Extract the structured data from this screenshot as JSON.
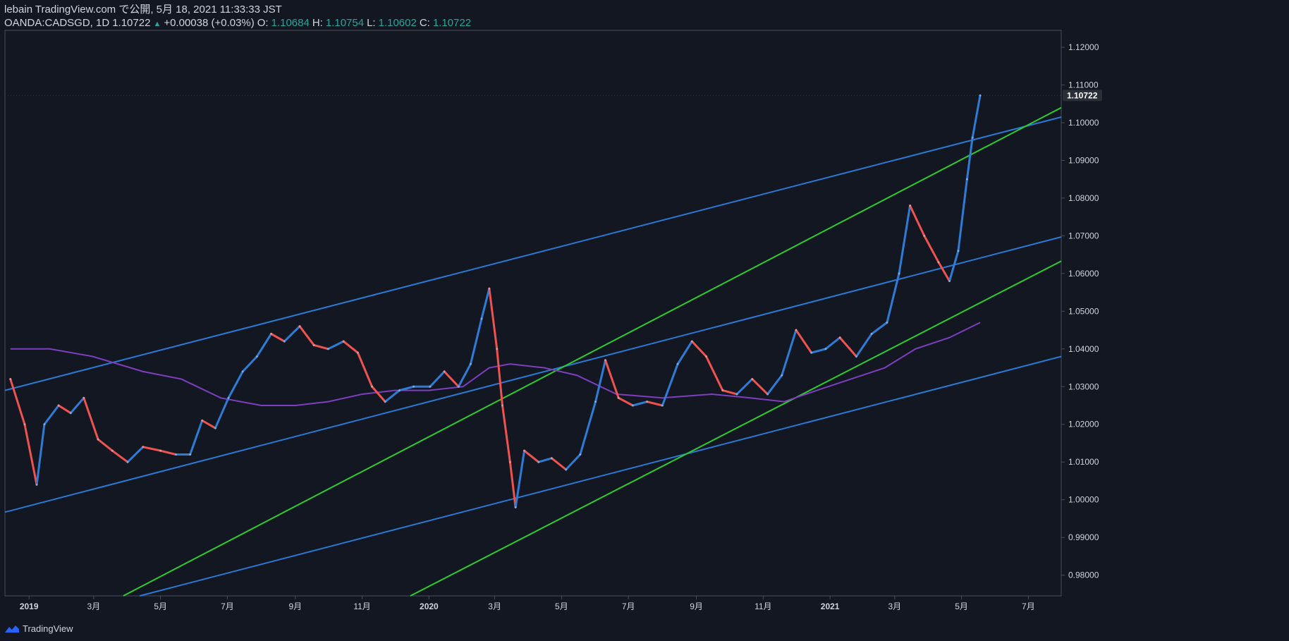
{
  "header": {
    "publisher": "lebain TradingView.com で公開, 5月 18, 2021 11:33:33 JST",
    "symbol": "OANDA:CADSGD, 1D",
    "last": "1.10722",
    "change": "+0.00038 (+0.03%)",
    "o_label": "O:",
    "o_value": "1.10684",
    "h_label": "H:",
    "h_value": "1.10754",
    "l_label": "L:",
    "l_value": "1.10602",
    "c_label": "C:",
    "c_value": "1.10722"
  },
  "footer": {
    "brand": "TradingView"
  },
  "chart_data": {
    "type": "line",
    "title": "",
    "xlabel": "",
    "ylabel": "",
    "ylim": [
      0.9745,
      1.1245
    ],
    "x_tick_labels": [
      "2019",
      "3月",
      "5月",
      "7月",
      "9月",
      "11月",
      "2020",
      "3月",
      "5月",
      "7月",
      "9月",
      "11月",
      "2021",
      "3月",
      "5月",
      "7月"
    ],
    "y_tick_labels": [
      "1.12000",
      "1.11000",
      "1.10000",
      "1.09000",
      "1.08000",
      "1.07000",
      "1.06000",
      "1.05000",
      "1.04000",
      "1.03000",
      "1.02000",
      "1.01000",
      "1.00000",
      "0.99000",
      "0.98000"
    ],
    "y_tick_values": [
      1.12,
      1.11,
      1.1,
      1.09,
      1.08,
      1.07,
      1.06,
      1.05,
      1.04,
      1.03,
      1.02,
      1.01,
      1.0,
      0.99,
      0.98
    ],
    "last_price_label": "1.10722",
    "last_price": 1.10722,
    "colors": {
      "background": "#131722",
      "up_candle": "#2e7cd6",
      "down_candle": "#ef5350",
      "moving_average": "#7e3fbf",
      "blue_trendline": "#2a7ad5",
      "green_trendline": "#2ecc2e",
      "text": "#d1d4dc",
      "axis_line": "#4a4e59"
    },
    "series": [
      {
        "values": [
          [
            "2018-12-15",
            1.032
          ],
          [
            "2018-12-28",
            1.02
          ],
          [
            "2019-01-08",
            1.004
          ],
          [
            "2019-01-15",
            1.02
          ],
          [
            "2019-01-28",
            1.025
          ],
          [
            "2019-02-08",
            1.023
          ],
          [
            "2019-02-20",
            1.027
          ],
          [
            "2019-03-05",
            1.016
          ],
          [
            "2019-03-18",
            1.013
          ],
          [
            "2019-04-01",
            1.01
          ],
          [
            "2019-04-15",
            1.014
          ],
          [
            "2019-05-01",
            1.013
          ],
          [
            "2019-05-15",
            1.012
          ],
          [
            "2019-05-28",
            1.012
          ],
          [
            "2019-06-08",
            1.021
          ],
          [
            "2019-06-20",
            1.019
          ],
          [
            "2019-07-02",
            1.027
          ],
          [
            "2019-07-15",
            1.034
          ],
          [
            "2019-07-28",
            1.038
          ],
          [
            "2019-08-10",
            1.044
          ],
          [
            "2019-08-22",
            1.042
          ],
          [
            "2019-09-05",
            1.046
          ],
          [
            "2019-09-18",
            1.041
          ],
          [
            "2019-10-01",
            1.04
          ],
          [
            "2019-10-15",
            1.042
          ],
          [
            "2019-10-28",
            1.039
          ],
          [
            "2019-11-10",
            1.03
          ],
          [
            "2019-11-22",
            1.026
          ],
          [
            "2019-12-05",
            1.029
          ],
          [
            "2019-12-18",
            1.03
          ],
          [
            "2020-01-02",
            1.03
          ],
          [
            "2020-01-15",
            1.034
          ],
          [
            "2020-01-28",
            1.03
          ],
          [
            "2020-02-08",
            1.036
          ],
          [
            "2020-02-18",
            1.048
          ],
          [
            "2020-02-25",
            1.056
          ],
          [
            "2020-03-03",
            1.04
          ],
          [
            "2020-03-08",
            1.025
          ],
          [
            "2020-03-15",
            1.01
          ],
          [
            "2020-03-20",
            0.998
          ],
          [
            "2020-03-28",
            1.013
          ],
          [
            "2020-04-10",
            1.01
          ],
          [
            "2020-04-22",
            1.011
          ],
          [
            "2020-05-05",
            1.008
          ],
          [
            "2020-05-18",
            1.012
          ],
          [
            "2020-06-01",
            1.026
          ],
          [
            "2020-06-10",
            1.037
          ],
          [
            "2020-06-22",
            1.027
          ],
          [
            "2020-07-05",
            1.025
          ],
          [
            "2020-07-18",
            1.026
          ],
          [
            "2020-08-01",
            1.025
          ],
          [
            "2020-08-15",
            1.036
          ],
          [
            "2020-08-28",
            1.042
          ],
          [
            "2020-09-10",
            1.038
          ],
          [
            "2020-09-25",
            1.029
          ],
          [
            "2020-10-08",
            1.028
          ],
          [
            "2020-10-22",
            1.032
          ],
          [
            "2020-11-05",
            1.028
          ],
          [
            "2020-11-18",
            1.033
          ],
          [
            "2020-12-01",
            1.045
          ],
          [
            "2020-12-15",
            1.039
          ],
          [
            "2020-12-28",
            1.04
          ],
          [
            "2021-01-10",
            1.043
          ],
          [
            "2021-01-25",
            1.038
          ],
          [
            "2021-02-08",
            1.044
          ],
          [
            "2021-02-22",
            1.047
          ],
          [
            "2021-03-05",
            1.06
          ],
          [
            "2021-03-15",
            1.078
          ],
          [
            "2021-03-28",
            1.07
          ],
          [
            "2021-04-10",
            1.063
          ],
          [
            "2021-04-20",
            1.058
          ],
          [
            "2021-04-28",
            1.066
          ],
          [
            "2021-05-06",
            1.085
          ],
          [
            "2021-05-11",
            1.096
          ],
          [
            "2021-05-18",
            1.10722
          ]
        ]
      },
      {
        "name": "",
        "values": [
          [
            "2018-12-15",
            1.04
          ],
          [
            "2019-01-20",
            1.04
          ],
          [
            "2019-02-28",
            1.038
          ],
          [
            "2019-04-15",
            1.034
          ],
          [
            "2019-05-20",
            1.032
          ],
          [
            "2019-06-25",
            1.027
          ],
          [
            "2019-08-01",
            1.025
          ],
          [
            "2019-09-01",
            1.025
          ],
          [
            "2019-10-01",
            1.026
          ],
          [
            "2019-11-01",
            1.028
          ],
          [
            "2019-12-01",
            1.029
          ],
          [
            "2020-01-01",
            1.029
          ],
          [
            "2020-02-01",
            1.03
          ],
          [
            "2020-02-25",
            1.035
          ],
          [
            "2020-03-15",
            1.036
          ],
          [
            "2020-04-15",
            1.035
          ],
          [
            "2020-05-15",
            1.033
          ],
          [
            "2020-06-20",
            1.028
          ],
          [
            "2020-08-01",
            1.027
          ],
          [
            "2020-09-15",
            1.028
          ],
          [
            "2020-10-20",
            1.027
          ],
          [
            "2020-11-20",
            1.026
          ],
          [
            "2020-12-20",
            1.029
          ],
          [
            "2021-01-20",
            1.032
          ],
          [
            "2021-02-20",
            1.035
          ],
          [
            "2021-03-20",
            1.04
          ],
          [
            "2021-04-20",
            1.043
          ],
          [
            "2021-05-18",
            1.047
          ]
        ]
      }
    ],
    "trendlines": [
      {
        "color": "blue",
        "from": [
          "2018-12-10",
          1.029
        ],
        "to": [
          "2021-07-31",
          1.1015
        ]
      },
      {
        "color": "blue",
        "from": [
          "2018-12-10",
          0.9967
        ],
        "to": [
          "2021-07-31",
          1.0697
        ]
      },
      {
        "color": "blue",
        "from": [
          "2019-04-12",
          0.9745
        ],
        "to": [
          "2021-07-31",
          1.038
        ]
      },
      {
        "color": "green",
        "from": [
          "2019-03-28",
          0.9745
        ],
        "to": [
          "2021-07-31",
          1.104
        ]
      },
      {
        "color": "green",
        "from": [
          "2019-12-15",
          0.9745
        ],
        "to": [
          "2021-07-31",
          1.0633
        ]
      }
    ]
  }
}
